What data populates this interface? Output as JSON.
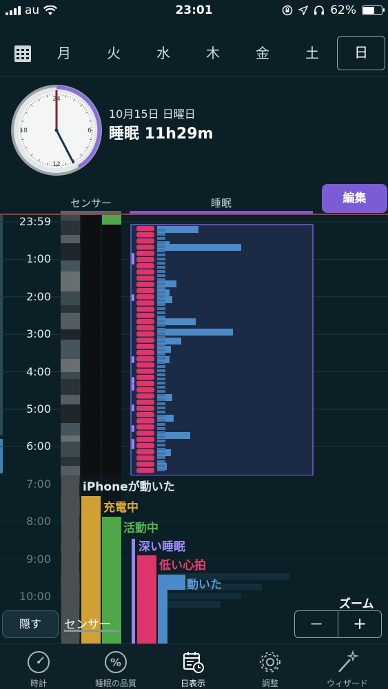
{
  "status_bar": {
    "carrier": "au",
    "time": "23:01",
    "battery": "62%",
    "battery_level": 0.62
  },
  "day_tabs": [
    "月",
    "火",
    "水",
    "木",
    "金",
    "土",
    "日"
  ],
  "selected_day": "日",
  "header": {
    "date": "10月15日 日曜日",
    "summary": "睡眠 11h29m"
  },
  "clock_numbers": [
    "6",
    "12",
    "18",
    "24"
  ],
  "edit_button": "編集",
  "columns": {
    "sensor": "センサー",
    "sleep": "睡眠"
  },
  "hour_labels": [
    "23:59",
    "1:00",
    "2:00",
    "3:00",
    "4:00",
    "5:00",
    "6:00",
    "7:00",
    "8:00",
    "9:00",
    "10:00"
  ],
  "legend": [
    {
      "key": "iphone",
      "label": "iPhoneが動いた",
      "color": "#d9dfe2"
    },
    {
      "key": "charging",
      "label": "充電中",
      "color": "#d1a033"
    },
    {
      "key": "activity",
      "label": "活動中",
      "color": "#4ea84a"
    },
    {
      "key": "deep",
      "label": "深い睡眠",
      "color": "#9a82ff"
    },
    {
      "key": "low_hr",
      "label": "低い心拍",
      "color": "#e0356a"
    },
    {
      "key": "moved",
      "label": "動いた",
      "color": "#4d8bc8"
    }
  ],
  "hide_button": "隠す",
  "sensor_label": "センサー",
  "zoom": {
    "label": "ズーム",
    "minus": "−",
    "plus": "+"
  },
  "tabs": [
    {
      "label": "時計",
      "icon": "gauge-icon"
    },
    {
      "label": "睡眠の品質",
      "icon": "percent-icon"
    },
    {
      "label": "日表示",
      "icon": "calendar-clock-icon"
    },
    {
      "label": "調整",
      "icon": "gear-icon"
    },
    {
      "label": "ウィザード",
      "icon": "magic-wand-icon"
    }
  ],
  "active_tab": "日表示"
}
